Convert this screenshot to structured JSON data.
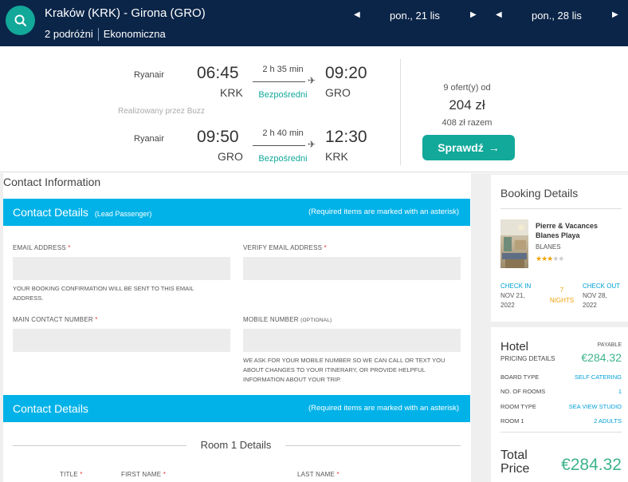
{
  "search": {
    "route": "Kraków (KRK) - Girona (GRO)",
    "passengers": "2 podróżni",
    "cabin": "Ekonomiczna",
    "depart_date": "pon., 21 lis",
    "return_date": "pon., 28 lis"
  },
  "flights": {
    "outbound": {
      "airline": "Ryanair",
      "dep_time": "06:45",
      "dep_code": "KRK",
      "duration": "2 h 35 min",
      "stops": "Bezpośredni",
      "arr_time": "09:20",
      "arr_code": "GRO"
    },
    "operated_by": "Realizowany przez Buzz",
    "inbound": {
      "airline": "Ryanair",
      "dep_time": "09:50",
      "dep_code": "GRO",
      "duration": "2 h 40 min",
      "stops": "Bezpośredni",
      "arr_time": "12:30",
      "arr_code": "KRK"
    },
    "offers_text": "9 ofert(y) od",
    "price": "204 zł",
    "total": "408 zł razem",
    "check_button": "Sprawdź"
  },
  "form": {
    "section_title": "Contact Information",
    "contact_bar": {
      "title": "Contact Details",
      "subtitle": "(Lead Passenger)",
      "required_note": "(Required items are marked with an asterisk)"
    },
    "email_label": "EMAIL ADDRESS",
    "verify_email_label": "VERIFY EMAIL ADDRESS",
    "email_help": "YOUR BOOKING CONFIRMATION WILL BE SENT TO THIS EMAIL ADDRESS.",
    "main_contact_label": "MAIN CONTACT NUMBER",
    "mobile_label": "MOBILE NUMBER",
    "mobile_optional": "(OPTIONAL)",
    "mobile_help": "WE ASK FOR YOUR MOBILE NUMBER SO WE CAN CALL OR TEXT YOU ABOUT CHANGES TO YOUR ITINERARY, OR PROVIDE HELPFUL INFORMATION ABOUT YOUR TRIP.",
    "contact_bar2": {
      "title": "Contact Details",
      "required_note": "(Required items are marked with an asterisk)"
    },
    "room_title": "Room 1 Details",
    "title_label": "TITLE",
    "first_name_label": "FIRST NAME",
    "last_name_label": "LAST NAME",
    "asterisk": "*"
  },
  "booking": {
    "title": "Booking Details",
    "hotel_name": "Pierre & Vacances Blanes Playa",
    "hotel_location": "BLANES",
    "stars": 3,
    "star_full": "★★★",
    "star_empty": "★★",
    "check_in_label": "CHECK IN",
    "check_in_date": "NOV 21, 2022",
    "nights": "7 NIGHTS",
    "check_out_label": "CHECK OUT",
    "check_out_date": "NOV 28, 2022"
  },
  "pricing": {
    "hotel_label": "Hotel",
    "payable_label": "PAYABLE",
    "pricing_details_label": "PRICING DETAILS",
    "hotel_price": "€284.32",
    "rows": [
      {
        "label": "BOARD TYPE",
        "value": "SELF CATERING"
      },
      {
        "label": "NO. OF ROOMS",
        "value": "1"
      },
      {
        "label": "ROOM TYPE",
        "value": "SEA VIEW STUDIO"
      },
      {
        "label": "ROOM 1",
        "value": "2 ADULTS"
      }
    ],
    "total_label_1": "Total",
    "total_label_2": "Price",
    "total_price": "€284.32"
  },
  "colors": {
    "navy": "#0b2548",
    "teal": "#12a89a",
    "blue_bar": "#00b2e8",
    "link_blue": "#00a0d6",
    "orange": "#f0a30a",
    "price_green": "#3db48a",
    "required_red": "#e53935"
  }
}
